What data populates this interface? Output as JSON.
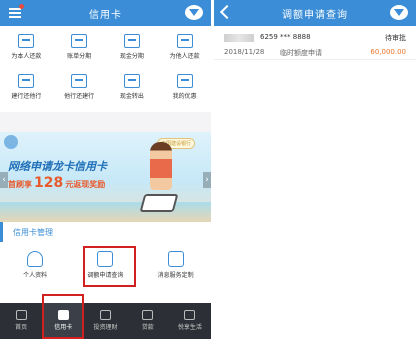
{
  "left": {
    "title": "信用卡",
    "quick_actions": [
      {
        "label": "为本人还款",
        "icon": "repay-icon"
      },
      {
        "label": "账单分期",
        "icon": "bill-installment-icon"
      },
      {
        "label": "现金分期",
        "icon": "cash-installment-icon"
      },
      {
        "label": "为他人还款",
        "icon": "repay-others-icon"
      },
      {
        "label": "建行还他行",
        "icon": "transfer-out-icon"
      },
      {
        "label": "他行还建行",
        "icon": "transfer-in-icon"
      },
      {
        "label": "现金转出",
        "icon": "cash-out-icon"
      },
      {
        "label": "我的优惠",
        "icon": "coupon-icon"
      }
    ],
    "banner": {
      "line1": "网络申请龙卡信用卡",
      "line2_prefix": "首刷享",
      "line2_amount": "128",
      "line2_suffix": "元返现奖励",
      "badge": "中国建设银行"
    },
    "section_title": "信用卡管理",
    "manage_items": [
      {
        "label": "个人资料",
        "icon": "person-icon"
      },
      {
        "label": "调额申请查询",
        "icon": "limit-query-icon"
      },
      {
        "label": "消息服务定制",
        "icon": "message-icon"
      }
    ],
    "tabs": [
      {
        "label": "首页",
        "icon": "home-icon"
      },
      {
        "label": "信用卡",
        "icon": "credit-card-icon"
      },
      {
        "label": "投资理财",
        "icon": "investment-icon"
      },
      {
        "label": "贷款",
        "icon": "loan-icon"
      },
      {
        "label": "悦享生活",
        "icon": "life-icon"
      }
    ],
    "active_tab": "信用卡"
  },
  "right": {
    "title": "调额申请查询",
    "records": [
      {
        "card": "6259 *** 8888",
        "status": "待审批",
        "date": "2018/11/28",
        "type": "临时额度申请",
        "amount": "60,000.00"
      }
    ]
  },
  "colors": {
    "primary": "#3a8dd6",
    "highlight": "#d21f1f",
    "amount": "#e8762c",
    "tabbar": "#2c2f35"
  }
}
